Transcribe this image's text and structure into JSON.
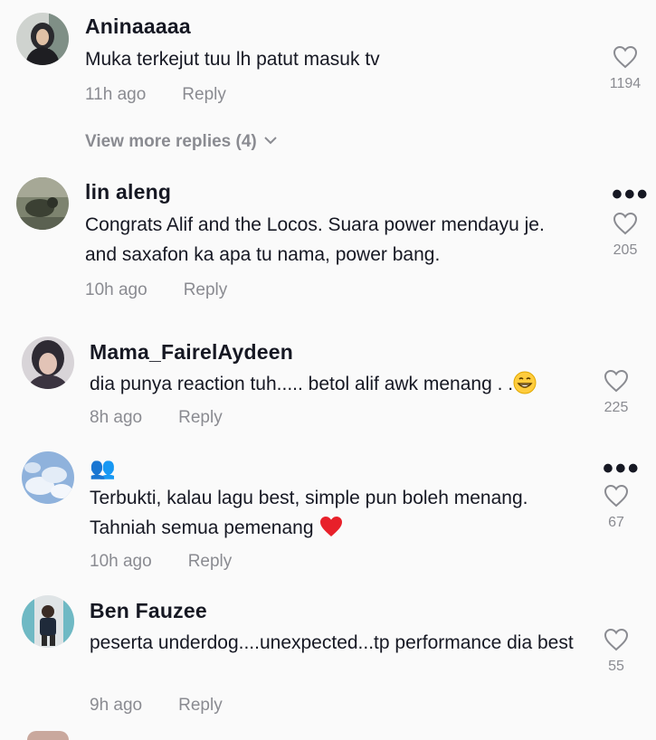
{
  "comments": [
    {
      "username": "Aninaaaaa",
      "text": "Muka terkejut tuu lh patut masuk tv",
      "time": "11h ago",
      "reply": "Reply",
      "likes": "1194",
      "more_replies": "View more replies (4)",
      "avatar_icon": "profile-photo-hijab"
    },
    {
      "username": "lin aleng",
      "text": "Congrats Alif and the Locos. Suara power mendayu je. and saxafon ka apa tu nama, power bang.",
      "time": "10h ago",
      "reply": "Reply",
      "likes": "205",
      "avatar_icon": "profile-photo-bird"
    },
    {
      "username": "Mama_FairelAydeen",
      "text": "dia punya reaction tuh..... betol alif awk menang . .",
      "emoji": "😁",
      "time": "8h ago",
      "reply": "Reply",
      "likes": "225",
      "avatar_icon": "profile-photo-woman"
    },
    {
      "username": "👥",
      "text": "Terbukti, kalau lagu best, simple pun boleh menang. Tahniah semua pemenang",
      "emoji": "❤️",
      "time": "10h ago",
      "reply": "Reply",
      "likes": "67",
      "avatar_icon": "profile-photo-clouds"
    },
    {
      "username": "Ben Fauzee",
      "text": "peserta underdog....unexpected...tp performance dia best",
      "time": "9h ago",
      "reply": "Reply",
      "likes": "55",
      "avatar_icon": "profile-photo-man"
    }
  ],
  "colors": {
    "background": "#fafafa",
    "primary_text": "#161823",
    "secondary_text": "#8a8b91"
  }
}
